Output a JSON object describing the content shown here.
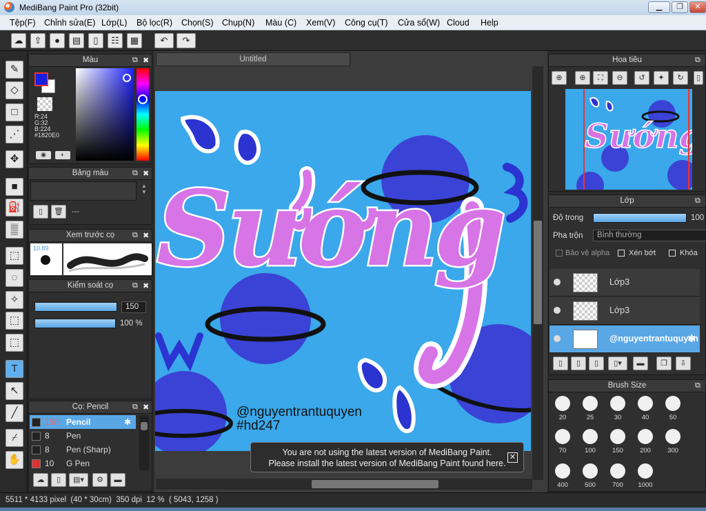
{
  "window": {
    "title": "MediBang Paint Pro (32bit)"
  },
  "menu": [
    "Tệp(F)",
    "Chỉnh sửa(E)",
    "Lớp(L)",
    "Bộ lọc(R)",
    "Chọn(S)",
    "Chụp(N)",
    "Màu (C)",
    "Xem(V)",
    "Công cụ(T)",
    "Cửa sổ(W)",
    "Cloud",
    "Help"
  ],
  "toolbar_icons": [
    "cloud-icon",
    "share-icon",
    "comment-icon",
    "message-icon",
    "page-icon",
    "list-icon",
    "grid-icon",
    "undo-icon",
    "redo-icon"
  ],
  "color_panel": {
    "title": "Màu",
    "r": "R:24",
    "g": "G:32",
    "b": "B:224",
    "hex": "#1820E0",
    "primary": "#1820E0"
  },
  "palette_panel": {
    "title": "Bảng màu",
    "value": "---"
  },
  "brush_preview": {
    "title": "Xem trước cọ",
    "size": "10.89"
  },
  "brush_control": {
    "title": "Kiểm soát cọ",
    "size": "150",
    "opacity": "100 %",
    "size_pct": 1.0,
    "opacity_pct": 1.0
  },
  "brush_list": {
    "title": "Cọ: Pencil",
    "items": [
      {
        "num": "150",
        "name": "Pencil",
        "selected": true,
        "color": "#222222"
      },
      {
        "num": "8",
        "name": "Pen",
        "selected": false,
        "color": "#222222"
      },
      {
        "num": "8",
        "name": "Pen (Sharp)",
        "selected": false,
        "color": "#222222"
      },
      {
        "num": "10",
        "name": "G Pen",
        "selected": false,
        "color": "#e03030"
      }
    ]
  },
  "canvas": {
    "tab": "Untitled",
    "word": "Sướng",
    "handle": "@nguyentrantuquyen",
    "tag": "#hd247",
    "bg": "#3aa8ea",
    "accent": "#d774e6",
    "planet": "#3b43d6"
  },
  "notice": {
    "line1": "You are not using the latest version of MediBang Paint.",
    "line2": "Please install the latest version of MediBang Paint found here."
  },
  "navigator": {
    "title": "Hoa tiêu"
  },
  "layer_panel": {
    "title": "Lớp",
    "opacity_label": "Độ trong",
    "opacity_value": "100",
    "blend_label": "Pha trộn",
    "blend_value": "Bình thường",
    "protect_alpha": "Bảo vệ alpha",
    "clipping": "Xén bớt",
    "lock": "Khóa",
    "layers": [
      {
        "name": "Lớp3",
        "selected": false
      },
      {
        "name": "Lớp3",
        "selected": false
      },
      {
        "name": "@nguyentrantuquyen",
        "selected": true
      }
    ]
  },
  "brush_size": {
    "title": "Brush Size",
    "sizes": [
      "20",
      "25",
      "30",
      "40",
      "50",
      "70",
      "100",
      "150",
      "200",
      "300",
      "400",
      "500",
      "700",
      "1000"
    ]
  },
  "status": {
    "text": "5511 * 4133 pixel  (40 * 30cm)  350 dpi  12 %  ( 5043, 1258 )"
  }
}
